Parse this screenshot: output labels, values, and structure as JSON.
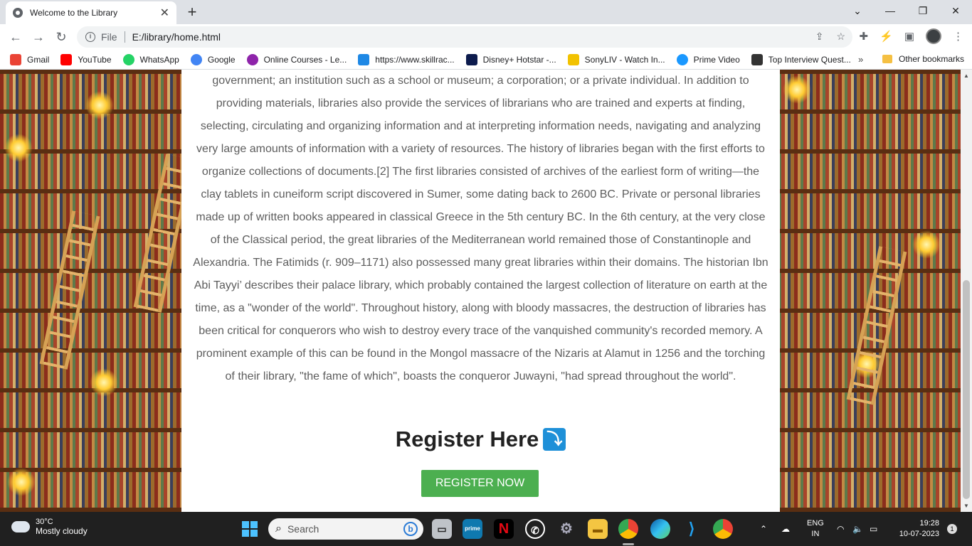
{
  "browser": {
    "tab_title": "Welcome to the Library",
    "url_scheme": "File",
    "url": "E:/library/home.html",
    "bookmarks": [
      {
        "label": "Gmail",
        "color": "#ea4335"
      },
      {
        "label": "YouTube",
        "color": "#ff0000"
      },
      {
        "label": "WhatsApp",
        "color": "#25d366"
      },
      {
        "label": "Google",
        "color": "#4285f4"
      },
      {
        "label": "Online Courses - Le...",
        "color": "#8e24aa"
      },
      {
        "label": "https://www.skillrac...",
        "color": "#1e88e5"
      },
      {
        "label": "Disney+ Hotstar -...",
        "color": "#0c1b4d"
      },
      {
        "label": "SonyLIV - Watch In...",
        "color": "#f2c200"
      },
      {
        "label": "Prime Video",
        "color": "#1a98ff"
      },
      {
        "label": "Top Interview Quest...",
        "color": "#333333"
      }
    ],
    "other_bookmarks": "Other bookmarks",
    "more_chevron": "»"
  },
  "page": {
    "paragraph": "government; an institution such as a school or museum; a corporation; or a private individual. In addition to providing materials, libraries also provide the services of librarians who are trained and experts at finding, selecting, circulating and organizing information and at interpreting information needs, navigating and analyzing very large amounts of information with a variety of resources. The history of libraries began with the first efforts to organize collections of documents.[2] The first libraries consisted of archives of the earliest form of writing—the clay tablets in cuneiform script discovered in Sumer, some dating back to 2600 BC. Private or personal libraries made up of written books appeared in classical Greece in the 5th century BC. In the 6th century, at the very close of the Classical period, the great libraries of the Mediterranean world remained those of Constantinople and Alexandria. The Fatimids (r. 909–1171) also possessed many great libraries within their domains. The historian Ibn Abi Tayyi’ describes their palace library, which probably contained the largest collection of literature on earth at the time, as a \"wonder of the world\". Throughout history, along with bloody massacres, the destruction of libraries has been critical for conquerors who wish to destroy every trace of the vanquished community's recorded memory. A prominent example of this can be found in the Mongol massacre of the Nizaris at Alamut in 1256 and the torching of their library, \"the fame of which\", boasts the conqueror Juwayni, \"had spread throughout the world\".",
    "register_heading": "Register Here",
    "register_arrow": "⤵",
    "register_button": "REGISTER NOW",
    "scroll_position_fraction": 0.62
  },
  "taskbar": {
    "temperature": "30°C",
    "weather": "Mostly cloudy",
    "search_placeholder": "Search",
    "lang_top": "ENG",
    "lang_bottom": "IN",
    "time": "19:28",
    "date": "10-07-2023",
    "notification_count": "1"
  }
}
